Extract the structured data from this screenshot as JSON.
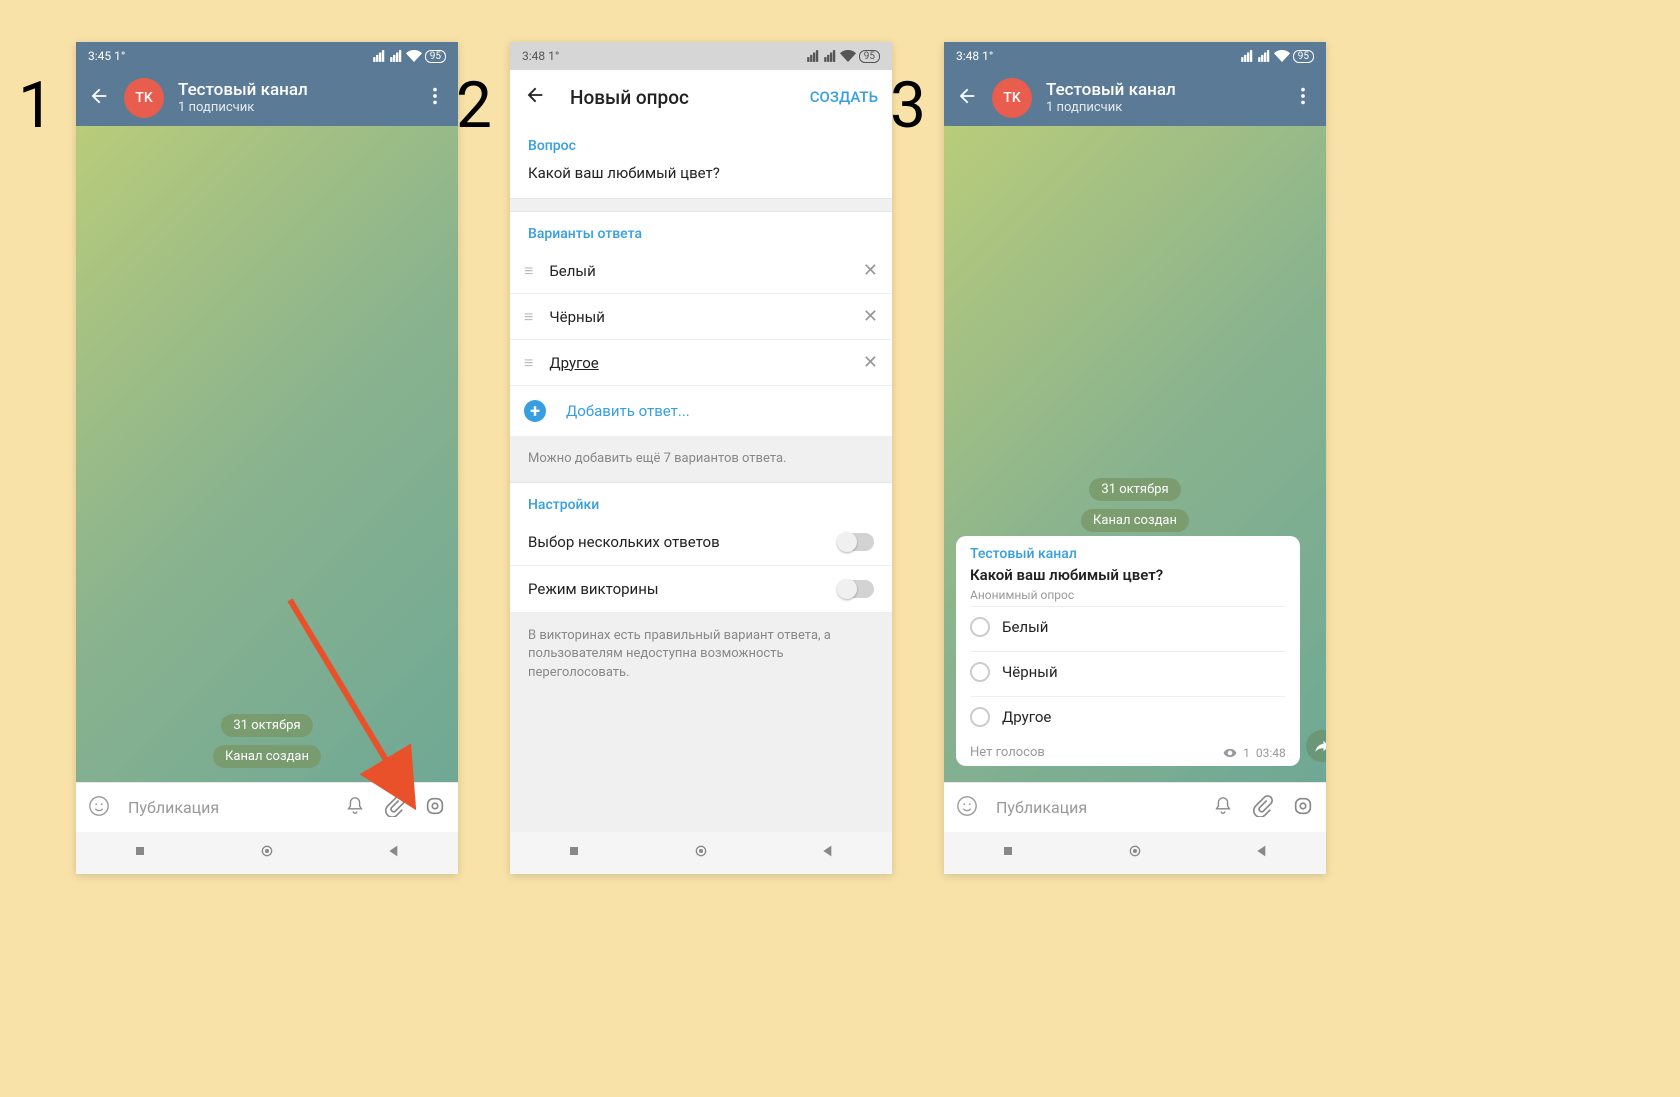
{
  "steps": {
    "one": "1",
    "two": "2",
    "three": "3"
  },
  "status": {
    "time1": "3:45",
    "time2": "3:48",
    "time3": "3:48",
    "temp": "1°",
    "battery": "95"
  },
  "channel": {
    "avatar": "TK",
    "title": "Тестовый канал",
    "subscribers": "1 подписчик"
  },
  "chat": {
    "date": "31 октября",
    "system_msg": "Канал создан",
    "input_placeholder": "Публикация"
  },
  "poll_editor": {
    "header": "Новый опрос",
    "create": "СОЗДАТЬ",
    "question_label": "Вопрос",
    "question": "Какой ваш любимый цвет?",
    "answers_label": "Варианты ответа",
    "options": [
      "Белый",
      "Чёрный",
      "Другое"
    ],
    "add_option": "Добавить ответ...",
    "hint_remaining": "Можно добавить ещё 7 вариантов ответа.",
    "settings_label": "Настройки",
    "multi_toggle": "Выбор нескольких ответов",
    "quiz_toggle": "Режим викторины",
    "quiz_hint": "В викторинах есть правильный вариант ответа, а пользователям недоступна возможность переголосовать."
  },
  "poll_message": {
    "channel": "Тестовый канал",
    "question": "Какой ваш любимый цвет?",
    "type": "Анонимный опрос",
    "options": [
      "Белый",
      "Чёрный",
      "Другое"
    ],
    "no_votes": "Нет голосов",
    "views": "1",
    "time": "03:48"
  }
}
